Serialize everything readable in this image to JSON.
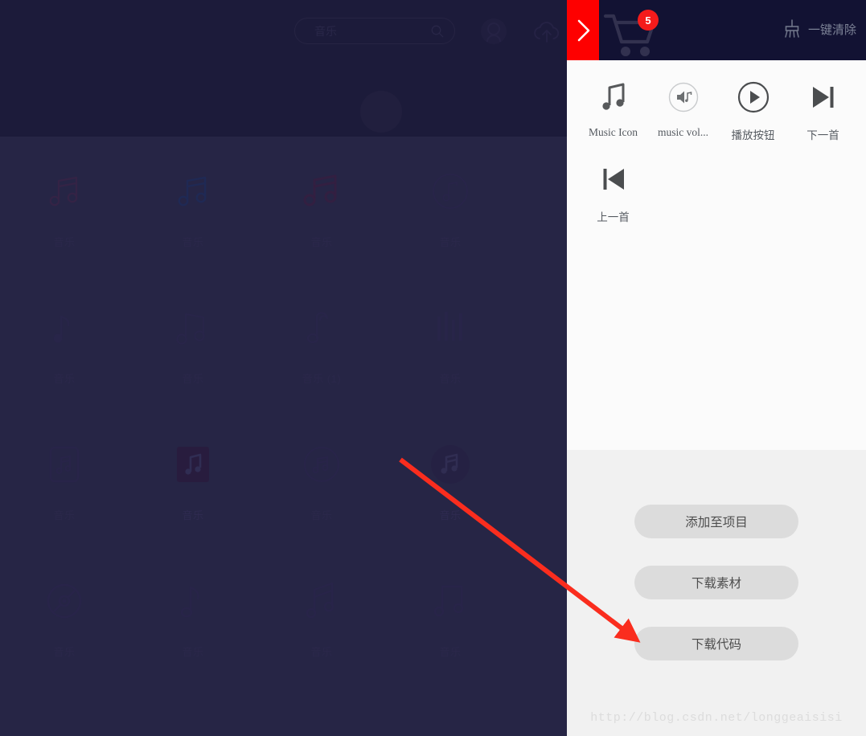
{
  "site": {
    "search": {
      "value": "音乐",
      "placeholder": "音乐",
      "icon": "search-icon"
    },
    "header_icons": [
      {
        "name": "avatar-icon",
        "label": "avatar"
      },
      {
        "name": "cloud-upload-icon",
        "label": "cloud upload"
      }
    ],
    "colors": {
      "header_bg": "#0d0c28",
      "body_bg": "#262545",
      "accent_red": "#fe0000",
      "badge_red": "#f41b1b",
      "drawer_bg": "#fbfbfb",
      "drawer_actions_bg": "#f1f1f1",
      "button_bg": "#dcdcdc"
    },
    "grid": [
      [
        {
          "label": "音乐",
          "icon": "beamed-note-icon"
        },
        {
          "label": "音乐",
          "icon": "beamed-note-icon"
        },
        {
          "label": "音乐",
          "icon": "beamed-note-bold-icon"
        },
        {
          "label": "音乐",
          "icon": "note-in-circle-icon"
        }
      ],
      [
        {
          "label": "音乐",
          "icon": "single-note-icon"
        },
        {
          "label": "音乐",
          "icon": "double-note-icon"
        },
        {
          "label": "音乐 (1)",
          "icon": "eighth-note-flourish-icon"
        },
        {
          "label": "音乐",
          "icon": "equalizer-bars-icon"
        }
      ],
      [
        {
          "label": "音乐",
          "icon": "note-in-rounded-square-outline-icon"
        },
        {
          "label": "音乐",
          "icon": "note-in-filled-square-icon"
        },
        {
          "label": "音乐",
          "icon": "note-in-circle-outline-icon"
        },
        {
          "label": "音乐",
          "icon": "note-in-filled-circle-icon"
        }
      ],
      [
        {
          "label": "音乐",
          "icon": "compact-disc-icon"
        },
        {
          "label": "音乐",
          "icon": "single-note-icon"
        },
        {
          "label": "音乐",
          "icon": "beamed-note-tall-icon"
        },
        {
          "label": "音乐",
          "icon": "beamed-note-wide-icon"
        }
      ]
    ]
  },
  "drawer": {
    "toggle": {
      "name": "drawer-collapse-toggle",
      "icon": "chevron-right-icon"
    },
    "cart": {
      "icon": "shopping-cart-icon",
      "badge_count": "5"
    },
    "clear_all": {
      "label": "一键清除",
      "icon": "broom-icon"
    },
    "items": [
      {
        "label": "Music Icon",
        "icon": "music-note-icon"
      },
      {
        "label": "music vol...",
        "icon": "volume-music-circle-icon"
      },
      {
        "label": "播放按钮",
        "icon": "play-circle-icon"
      },
      {
        "label": "下一首",
        "icon": "next-track-icon"
      },
      {
        "label": "上一首",
        "icon": "previous-track-icon"
      }
    ],
    "actions": [
      {
        "label": "添加至项目",
        "name": "add-to-project-button"
      },
      {
        "label": "下载素材",
        "name": "download-assets-button"
      },
      {
        "label": "下载代码",
        "name": "download-code-button"
      }
    ],
    "watermark": "http://blog.csdn.net/longgeaisisi"
  }
}
